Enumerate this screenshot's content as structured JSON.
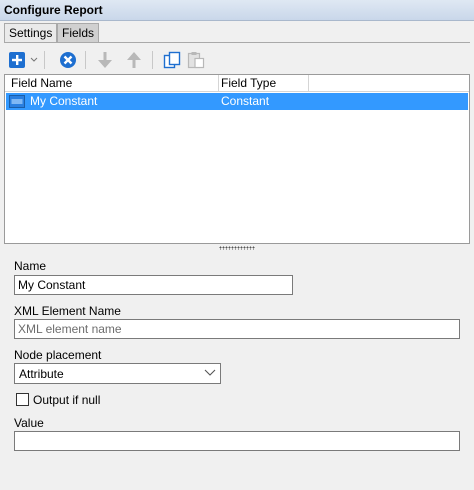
{
  "window": {
    "title": "Configure Report"
  },
  "tabs": [
    {
      "label": "Settings",
      "active": false
    },
    {
      "label": "Fields",
      "active": true
    }
  ],
  "toolbar": {
    "icons": [
      "add-icon",
      "dropdown-chevron-icon",
      "remove-icon",
      "move-down-icon",
      "move-up-icon",
      "copy-icon",
      "paste-icon"
    ]
  },
  "grid": {
    "columns": [
      "Field Name",
      "Field Type"
    ],
    "rows": [
      {
        "name": "My Constant",
        "type": "Constant",
        "icon": "abc-icon",
        "selected": true
      }
    ]
  },
  "form": {
    "name_label": "Name",
    "name_value": "My Constant",
    "xml_label": "XML Element Name",
    "xml_placeholder": "XML element name",
    "xml_value": "",
    "node_label": "Node placement",
    "node_value": "Attribute",
    "output_null_label": "Output if null",
    "output_null_checked": false,
    "value_label": "Value",
    "value_value": ""
  },
  "colors": {
    "accent": "#3399ff",
    "add_blue": "#1e6fd0",
    "remove_blue": "#1e6fd0",
    "disabled_gray": "#b8b8b8"
  }
}
